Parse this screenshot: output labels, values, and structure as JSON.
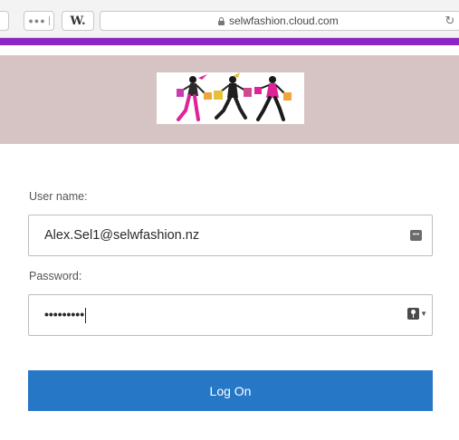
{
  "browser": {
    "tab_button_glyph": "W.",
    "url": "selwfashion.cloud.com",
    "reload_glyph": "↻"
  },
  "brand": {
    "bar_color": "#8c26c6",
    "banner_color": "#d6c4c4",
    "logo": "shopping-women-silhouettes-logo"
  },
  "form": {
    "username_label": "User name:",
    "username_value": "Alex.Sel1@selwfashion.nz",
    "password_label": "Password:",
    "password_value": "•••••••••",
    "submit_label": "Log On",
    "submit_color": "#2777c7"
  }
}
